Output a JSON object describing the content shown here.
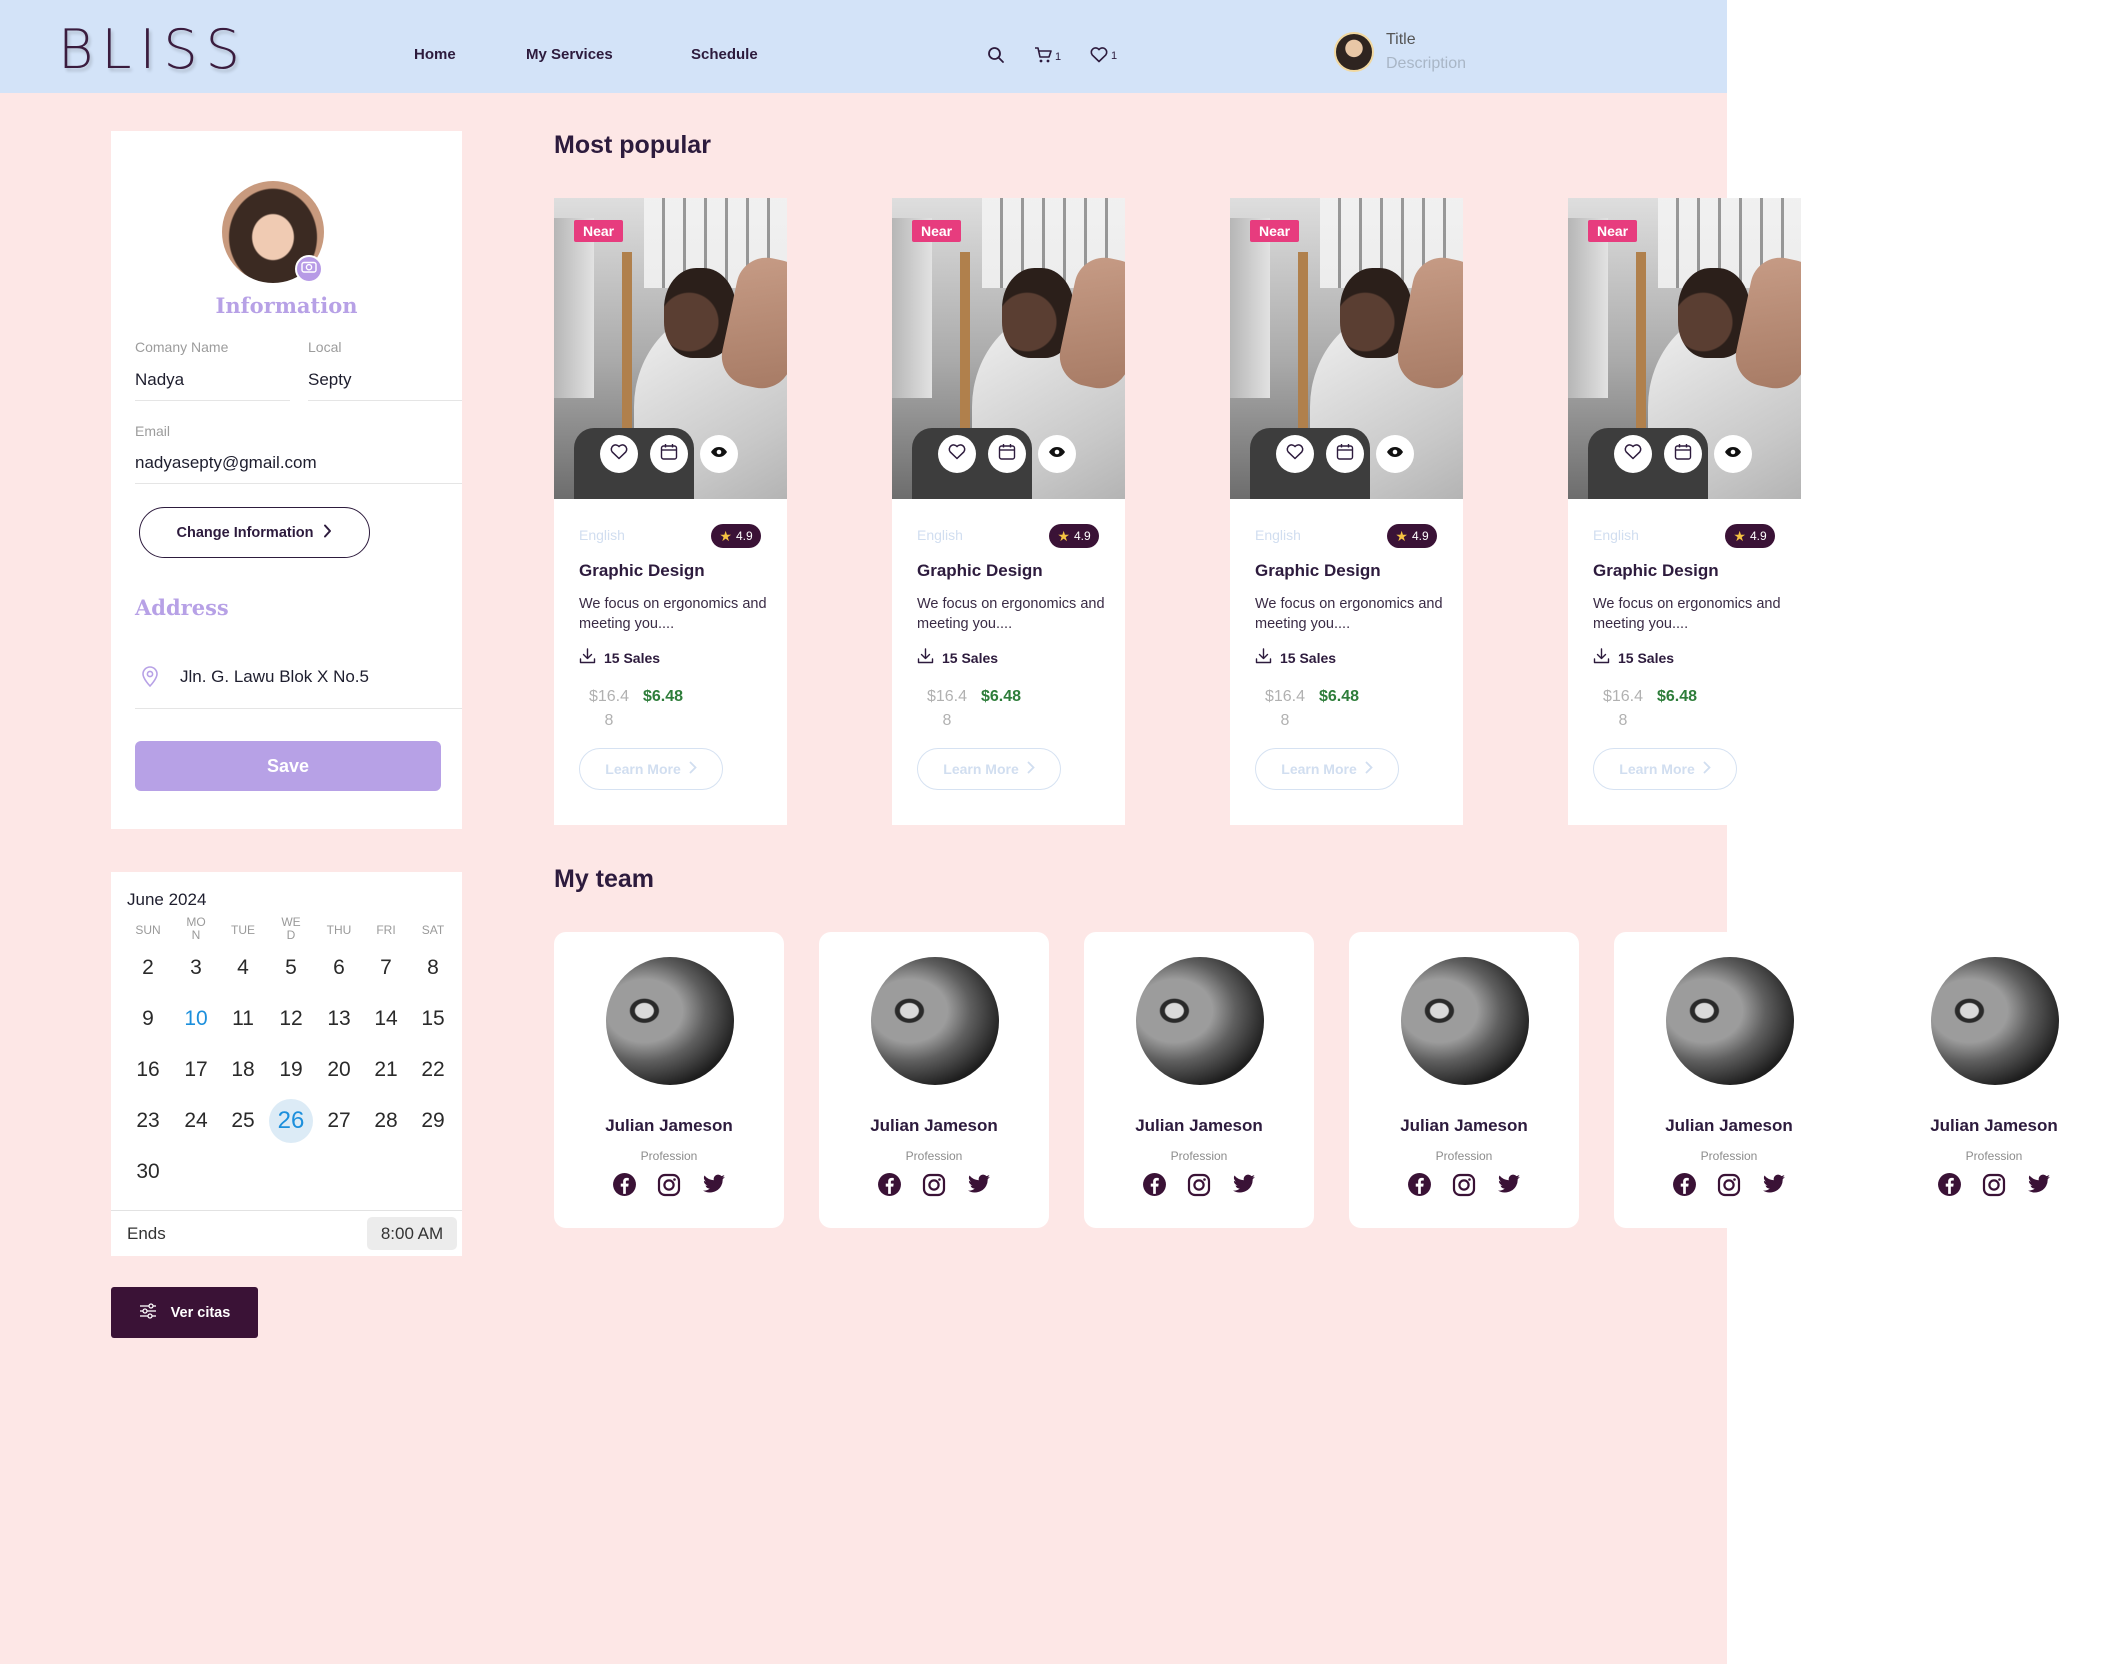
{
  "header": {
    "logo": "BLISS",
    "nav": [
      "Home",
      "My Services",
      "Schedule"
    ],
    "cart_count": "1",
    "favorites_count": "1",
    "user_title": "Title",
    "user_description": "Description"
  },
  "profile": {
    "heading": "Information",
    "company_label": "Comany Name",
    "company_value": "Nadya",
    "local_label": "Local",
    "local_value": "Septy",
    "email_label": "Email",
    "email_value": "nadyasepty@gmail.com",
    "change_button": "Change Information",
    "address_heading": "Address",
    "address_value": "Jln. G. Lawu Blok X No.5",
    "save_button": "Save"
  },
  "calendar": {
    "month_label": "June 2024",
    "weekdays": [
      "SUN",
      "MO\nN",
      "TUE",
      "WE\nD",
      "THU",
      "FRI",
      "SAT"
    ],
    "weeks": [
      [
        "2",
        "3",
        "4",
        "5",
        "6",
        "7",
        "8"
      ],
      [
        "9",
        "10",
        "11",
        "12",
        "13",
        "14",
        "15"
      ],
      [
        "16",
        "17",
        "18",
        "19",
        "20",
        "21",
        "22"
      ],
      [
        "23",
        "24",
        "25",
        "26",
        "27",
        "28",
        "29"
      ],
      [
        "30"
      ]
    ],
    "today": "10",
    "selected": "26",
    "ends_label": "Ends",
    "ends_time": "8:00 AM"
  },
  "ver_citas_button": "Ver citas",
  "popular": {
    "heading": "Most popular",
    "cards": [
      {
        "badge": "Near",
        "language": "English",
        "rating": "4.9",
        "title": "Graphic Design",
        "description": "We focus on ergonomics and meeting you....",
        "sales": "15 Sales",
        "price_old": "$16.48",
        "price_new": "$6.48",
        "cta": "Learn More"
      },
      {
        "badge": "Near",
        "language": "English",
        "rating": "4.9",
        "title": "Graphic Design",
        "description": "We focus on ergonomics and meeting you....",
        "sales": "15 Sales",
        "price_old": "$16.48",
        "price_new": "$6.48",
        "cta": "Learn More"
      },
      {
        "badge": "Near",
        "language": "English",
        "rating": "4.9",
        "title": "Graphic Design",
        "description": "We focus on ergonomics and meeting you....",
        "sales": "15 Sales",
        "price_old": "$16.48",
        "price_new": "$6.48",
        "cta": "Learn More"
      },
      {
        "badge": "Near",
        "language": "English",
        "rating": "4.9",
        "title": "Graphic Design",
        "description": "We focus on ergonomics and meeting you....",
        "sales": "15 Sales",
        "price_old": "$16.48",
        "price_new": "$6.48",
        "cta": "Learn More"
      }
    ]
  },
  "team": {
    "heading": "My team",
    "members": [
      {
        "name": "Julian Jameson",
        "profession": "Profession"
      },
      {
        "name": "Julian Jameson",
        "profession": "Profession"
      },
      {
        "name": "Julian Jameson",
        "profession": "Profession"
      },
      {
        "name": "Julian Jameson",
        "profession": "Profession"
      },
      {
        "name": "Julian Jameson",
        "profession": "Profession"
      },
      {
        "name": "Julian Jameson",
        "profession": "Profession"
      }
    ]
  },
  "icons": {
    "search": "search-icon",
    "cart": "cart-icon",
    "heart": "heart-icon",
    "camera": "camera-icon",
    "location": "location-pin-icon",
    "calendar": "calendar-icon",
    "eye": "eye-icon",
    "download": "download-icon",
    "star": "star-icon",
    "chevron": "chevron-right-icon",
    "filters": "sliders-icon",
    "facebook": "facebook-icon",
    "instagram": "instagram-icon",
    "twitter": "twitter-icon"
  },
  "colors": {
    "header_bg": "#d3e3f8",
    "page_bg": "#fde7e6",
    "accent_purple": "#b7a1e6",
    "dark_plum": "#3a1236",
    "badge_pink": "#e73c7e",
    "price_green": "#2e7d3a",
    "calendar_today": "#1c8fdc"
  }
}
